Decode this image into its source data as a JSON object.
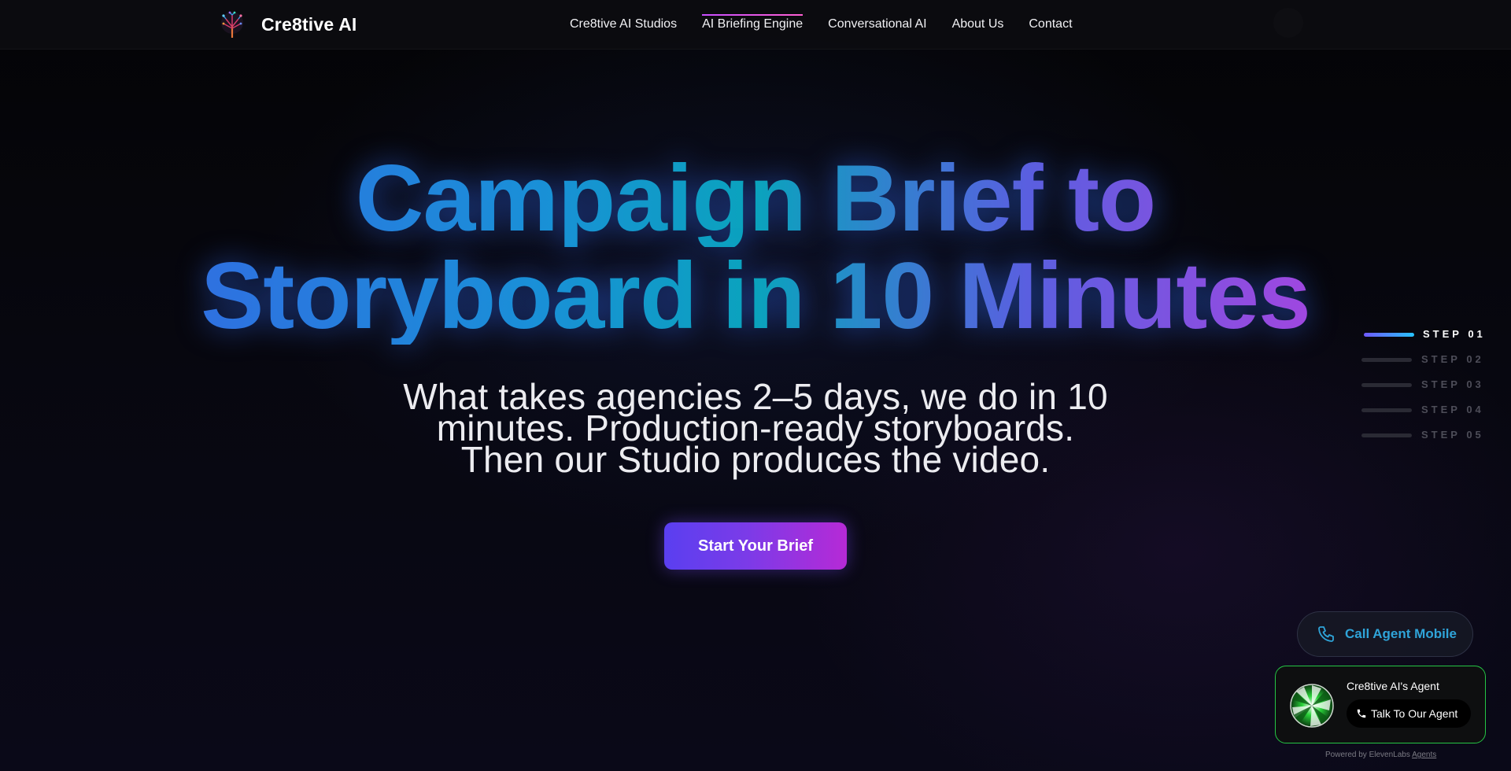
{
  "nav": {
    "brand": "Cre8tive AI",
    "links": [
      {
        "label": "Cre8tive AI Studios",
        "active": false
      },
      {
        "label": "AI Briefing Engine",
        "active": true
      },
      {
        "label": "Conversational AI",
        "active": false
      },
      {
        "label": "About Us",
        "active": false
      },
      {
        "label": "Contact",
        "active": false
      }
    ]
  },
  "hero": {
    "title_line1": "Campaign Brief to",
    "title_line2": "Storyboard in 10 Minutes",
    "subtitle_line1": "What takes agencies 2–5 days, we do in 10",
    "subtitle_line2": "minutes. Production-ready storyboards.",
    "subtitle_line3": "Then our Studio produces the video.",
    "cta": "Start Your Brief"
  },
  "steps": [
    {
      "label": "STEP 01",
      "active": true
    },
    {
      "label": "STEP 02",
      "active": false
    },
    {
      "label": "STEP 03",
      "active": false
    },
    {
      "label": "STEP 04",
      "active": false
    },
    {
      "label": "STEP 05",
      "active": false
    }
  ],
  "call_button": {
    "label": "Call Agent Mobile",
    "icon": "phone-icon"
  },
  "agent_widget": {
    "name": "Cre8tive AI's Agent",
    "talk_label": "Talk To Our Agent",
    "powered_prefix": "Powered by ElevenLabs",
    "powered_link": "Agents"
  },
  "colors": {
    "accent_blue": "#3b5ee6",
    "accent_cyan": "#0aa3bd",
    "accent_purple": "#c23ad6",
    "cta_start": "#5a3ff0",
    "cta_end": "#b62ad6",
    "agent_border": "#25c544",
    "call_text": "#2fa4d9"
  }
}
